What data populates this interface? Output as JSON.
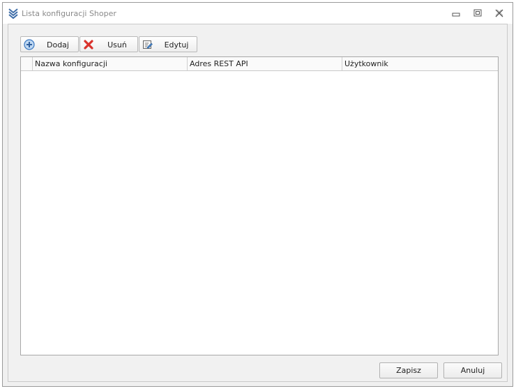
{
  "window": {
    "title": "Lista konfiguracji Shoper",
    "icon": "chevrons-down-icon",
    "controls": [
      "minimize-icon",
      "restore-icon",
      "close-icon"
    ]
  },
  "toolbar": {
    "add_label": "Dodaj",
    "add_icon": "add-circle-icon",
    "delete_label": "Usuń",
    "delete_icon": "red-x-icon",
    "edit_label": "Edytuj",
    "edit_icon": "edit-document-icon"
  },
  "grid": {
    "columns": [
      "Nazwa konfiguracji",
      "Adres REST API",
      "Użytkownik"
    ],
    "rows": []
  },
  "footer": {
    "save_label": "Zapisz",
    "cancel_label": "Anuluj"
  },
  "colors": {
    "title_text": "#8a8a8a",
    "app_icon": "#3e6da8",
    "add_icon": "#3a78c2",
    "delete_icon": "#d9322b"
  }
}
